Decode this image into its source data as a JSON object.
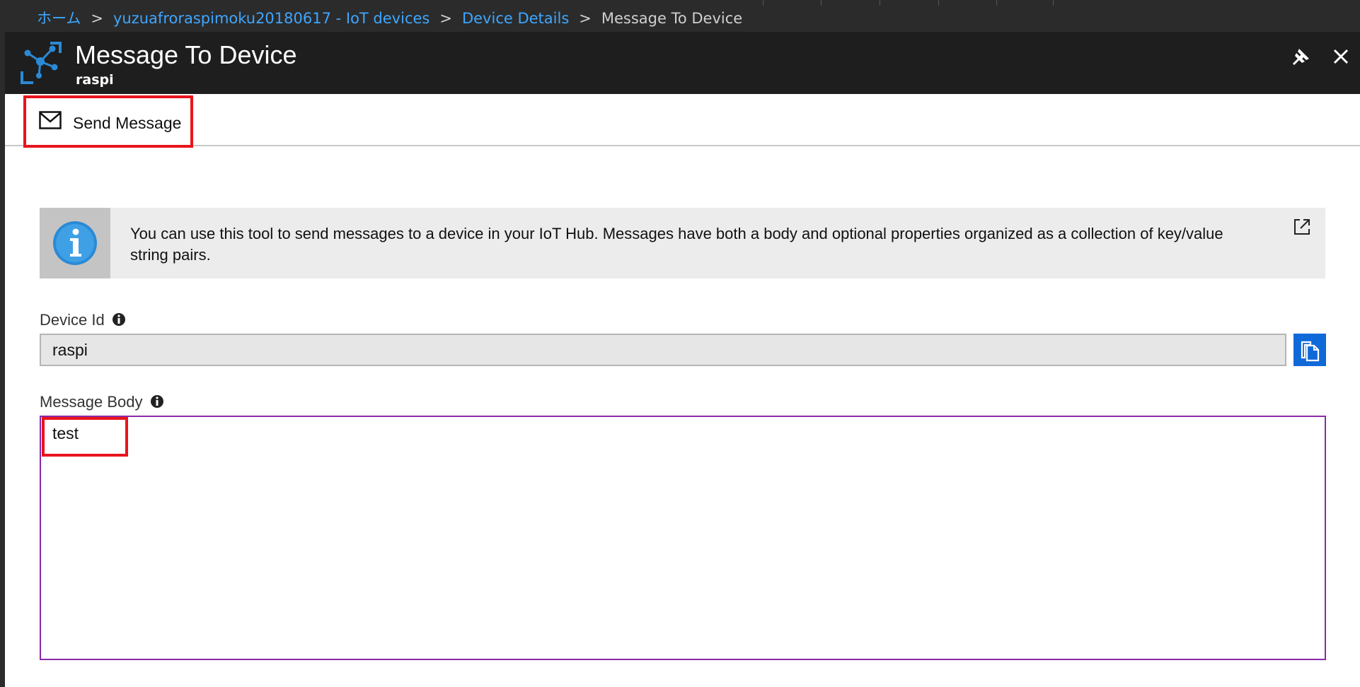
{
  "breadcrumb": {
    "home": "ホーム",
    "hub": "yuzuafroraspimoku20180617 - IoT devices",
    "details": "Device Details",
    "current": "Message To Device",
    "separator": ">"
  },
  "header": {
    "title": "Message To Device",
    "subtitle": "raspi",
    "icon": "iot-hub-icon"
  },
  "toolbar": {
    "send_label": "Send Message",
    "send_icon": "envelope-icon",
    "highlight_color": "#e8141c"
  },
  "info_banner": {
    "text": "You can use this tool to send messages to a device in your IoT Hub. Messages have both a body and optional properties organized as a collection of key/value string pairs.",
    "icon": "info-icon",
    "link_icon": "external-link-icon"
  },
  "device_id": {
    "label": "Device Id",
    "value": "raspi",
    "copy_icon": "copy-icon"
  },
  "message_body": {
    "label": "Message Body",
    "value": "test"
  },
  "colors": {
    "accent": "#1069d8",
    "link": "#3ea6ff",
    "focus_border": "#8a2aa8"
  }
}
